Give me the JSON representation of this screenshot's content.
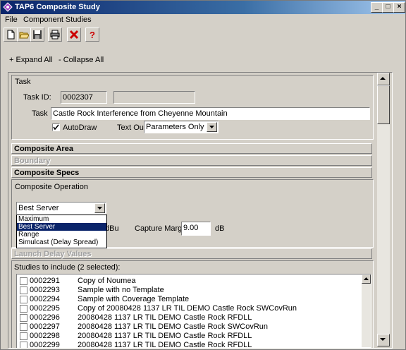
{
  "window": {
    "title": "TAP6 Composite Study"
  },
  "menu": {
    "items": [
      "File",
      "Component Studies"
    ]
  },
  "links": {
    "expand": "+ Expand All",
    "collapse": "- Collapse All"
  },
  "task": {
    "header": "Task",
    "id_label": "Task ID:",
    "id_value": "0002307",
    "id_extra": "",
    "task_label": "Task",
    "task_value": "Castle Rock Interference from Cheyenne Mountain",
    "autodraw_label": "AutoDraw",
    "autodraw_checked": true,
    "textout_label": "Text Out:",
    "textout_value": "Parameters Only"
  },
  "sections": {
    "composite_area": "Composite Area",
    "boundary": "Boundary",
    "composite_specs": "Composite Specs",
    "launch_delay": "Launch Delay Values"
  },
  "composite_op": {
    "label": "Composite Operation",
    "selected": "Best Server",
    "options": [
      "Maximum",
      "Best Server",
      "Range",
      "Simulcast (Delay Spread)"
    ],
    "unit_partial": "dBu",
    "capture_label": "Capture Margin",
    "capture_value": "9.00",
    "capture_unit": "dB"
  },
  "studies": {
    "label": "Studies to include (2 selected):",
    "rows": [
      {
        "id": "0002291",
        "name": "Copy of Noumea"
      },
      {
        "id": "0002293",
        "name": "Sample with no Template"
      },
      {
        "id": "0002294",
        "name": "Sample with Coverage Template"
      },
      {
        "id": "0002295",
        "name": "Copy of 20080428 1137 LR TIL DEMO Castle Rock SWCovRun"
      },
      {
        "id": "0002296",
        "name": "20080428 1137 LR TIL DEMO Castle Rock RFDLL"
      },
      {
        "id": "0002297",
        "name": "20080428 1137 LR TIL DEMO Castle Rock SWCovRun"
      },
      {
        "id": "0002298",
        "name": "20080428 1137 LR TIL DEMO Castle Rock RFDLL"
      },
      {
        "id": "0002299",
        "name": "20080428 1137 LR TIL DEMO Castle Rock RFDLL"
      }
    ]
  },
  "colors": {
    "title_start": "#0a246a",
    "title_end": "#a6caf0",
    "selection": "#0a246a",
    "delete_red": "#cc0000"
  }
}
